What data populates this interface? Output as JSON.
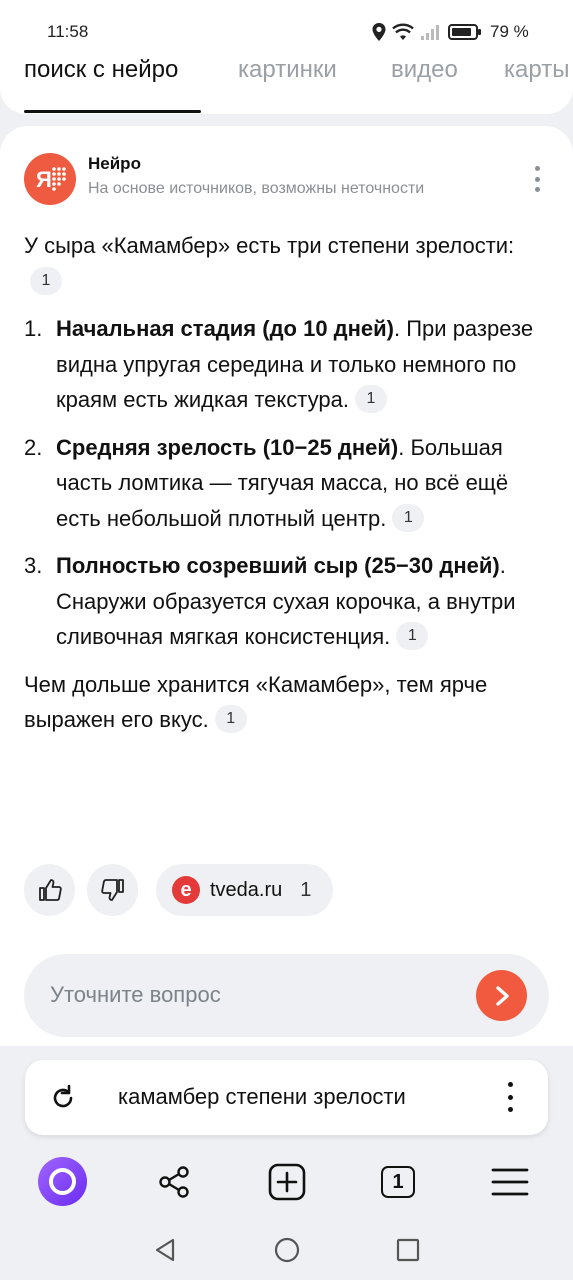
{
  "status_bar": {
    "time": "11:58",
    "battery": "79 %",
    "icons": [
      "location-icon",
      "wifi-icon",
      "signal-icon",
      "battery-icon"
    ]
  },
  "tabs": [
    {
      "label": "поиск с нейро",
      "active": true
    },
    {
      "label": "картинки",
      "active": false
    },
    {
      "label": "видео",
      "active": false
    },
    {
      "label": "карты",
      "active": false
    }
  ],
  "neuro": {
    "title": "Нейро",
    "subtitle": "На основе источников, возможны неточности",
    "logo_text": "Я"
  },
  "answer": {
    "intro": "У сыра «Камамбер» есть три степени зрелости:",
    "intro_cite": "1",
    "items": [
      {
        "num": "1.",
        "bold": "Начальная стадия (до 10 дней)",
        "text": ". При разрезе видна упругая середина и только немного по краям есть жидкая текстура.",
        "cite": "1"
      },
      {
        "num": "2.",
        "bold": "Средняя зрелость (10−25 дней)",
        "text": ". Большая часть ломтика — тягучая масса, но всё ещё есть небольшой плотный центр.",
        "cite": "1"
      },
      {
        "num": "3.",
        "bold": "Полностью созревший сыр (25−30 дней)",
        "text": ". Снаружи образуется сухая корочка, а внутри сливочная мягкая консистенция.",
        "cite": "1"
      }
    ],
    "closing": "Чем дольше хранится «Камамбер», тем ярче выражен его вкус.",
    "closing_cite": "1"
  },
  "feedback": {
    "source_logo": "e",
    "source_name": "tveda.ru",
    "source_count": "1"
  },
  "ask": {
    "placeholder": "Уточните вопрос"
  },
  "omnibar": {
    "query": "камамбер степени зрелости"
  },
  "toolbar": {
    "tab_count": "1"
  },
  "colors": {
    "accent": "#f25a3f",
    "alice": "#7a3cf5",
    "muted": "#8a8f96"
  }
}
